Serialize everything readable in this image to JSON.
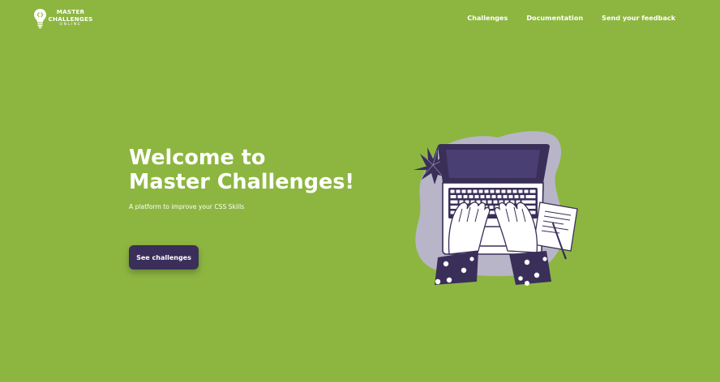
{
  "brand": {
    "line1": "MASTER",
    "line2": "CHALLENGES",
    "line3": "ONLINE",
    "icon": "lightbulb-code-icon"
  },
  "nav": {
    "items": [
      {
        "label": "Challenges"
      },
      {
        "label": "Documentation"
      },
      {
        "label": "Send your feedback"
      }
    ]
  },
  "hero": {
    "title_line1": "Welcome to",
    "title_line2": "Master Challenges!",
    "subtitle": "A platform to improve your CSS Skills",
    "cta_label": "See challenges"
  },
  "colors": {
    "background": "#8db641",
    "button": "#3a2f59",
    "text": "#ffffff",
    "illustration_blob": "#b8b5c9",
    "illustration_dark": "#3a2f59"
  },
  "illustration": {
    "icon": "person-typing-on-laptop-illustration"
  }
}
